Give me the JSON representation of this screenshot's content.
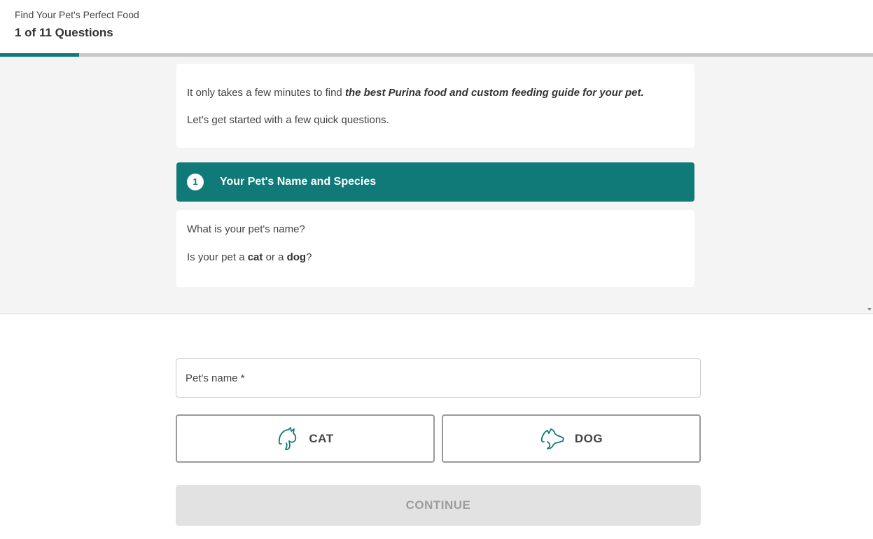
{
  "header": {
    "subtitle": "Find Your Pet's Perfect Food",
    "progress_label": "1 of 11 Questions",
    "progress_fraction": 0.0909
  },
  "intro": {
    "line1_prefix": "It only takes a few minutes to find ",
    "line1_bold": "the best Purina food and custom feeding guide for your pet.",
    "line2": "Let's get started with a few quick questions."
  },
  "section": {
    "number": "1",
    "title": "Your Pet's Name and Species"
  },
  "questions": {
    "q1": "What is your pet's name?",
    "q2_prefix": "Is your pet a ",
    "q2_cat": "cat",
    "q2_mid": " or a ",
    "q2_dog": "dog",
    "q2_suffix": "?"
  },
  "form": {
    "name_placeholder": "Pet's name *",
    "name_value": "",
    "cat_label": "CAT",
    "dog_label": "DOG",
    "cat_icon": "cat-icon",
    "dog_icon": "dog-icon",
    "continue_label": "CONTINUE"
  },
  "colors": {
    "accent": "#0f7a78",
    "disabled_bg": "#e2e2e2",
    "disabled_text": "#9d9d9d"
  }
}
